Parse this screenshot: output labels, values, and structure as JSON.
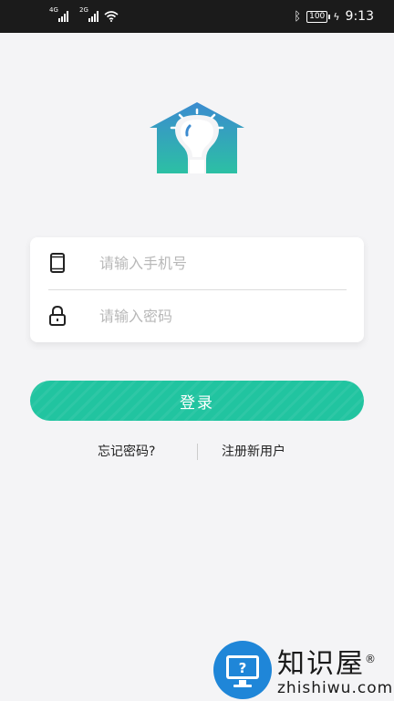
{
  "status_bar": {
    "network_1": "4G",
    "network_2": "2G",
    "battery": "100",
    "time": "9:13"
  },
  "logo": {
    "icon": "house-lightbulb-icon",
    "colors": {
      "top": "#3b8bd0",
      "bottom": "#2cc0a4"
    }
  },
  "login_form": {
    "phone_placeholder": "请输入手机号",
    "password_placeholder": "请输入密码",
    "phone_icon": "phone-icon",
    "password_icon": "lock-icon"
  },
  "login_button": {
    "label": "登录",
    "color": "#21c4a0"
  },
  "links": {
    "forgot_password": "忘记密码?",
    "register": "注册新用户"
  },
  "watermark": {
    "title": "知识屋",
    "registered": "®",
    "subtitle": "zhishiwu.com"
  }
}
